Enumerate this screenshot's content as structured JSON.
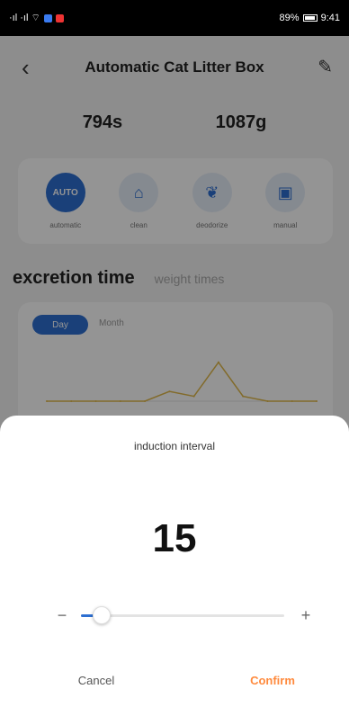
{
  "status_bar": {
    "left_text": "·ıl ·ıl ⌔",
    "right_text": "89%",
    "time": "9:41"
  },
  "header": {
    "title": "Automatic Cat Litter Box"
  },
  "stats": {
    "duration": "794s",
    "weight": "1087g"
  },
  "modes": [
    {
      "label": "automatic",
      "icon": "auto-icon",
      "text": "AUTO"
    },
    {
      "label": "clean",
      "icon": "bin-icon",
      "text": ""
    },
    {
      "label": "deodorize",
      "icon": "leaf-icon",
      "text": ""
    },
    {
      "label": "manual",
      "icon": "box-icon",
      "text": ""
    }
  ],
  "tabs": {
    "main": "excretion time",
    "secondary": "weight times"
  },
  "chart_controls": {
    "day": "Day",
    "month": "Month"
  },
  "chart_data": {
    "type": "line",
    "title": "",
    "xlabel": "",
    "ylabel": "",
    "series": [
      {
        "values": [
          0,
          0,
          0,
          0,
          0,
          2,
          1,
          8,
          1,
          0,
          0,
          0
        ]
      }
    ],
    "ylim": [
      0,
      10
    ]
  },
  "sheet": {
    "title": "induction interval",
    "value": "15",
    "minus": "−",
    "plus": "+",
    "slider_fraction": 0.1,
    "cancel": "Cancel",
    "confirm": "Confirm"
  },
  "colors": {
    "accent": "#2d6fd1",
    "confirm": "#ff8a3d"
  }
}
